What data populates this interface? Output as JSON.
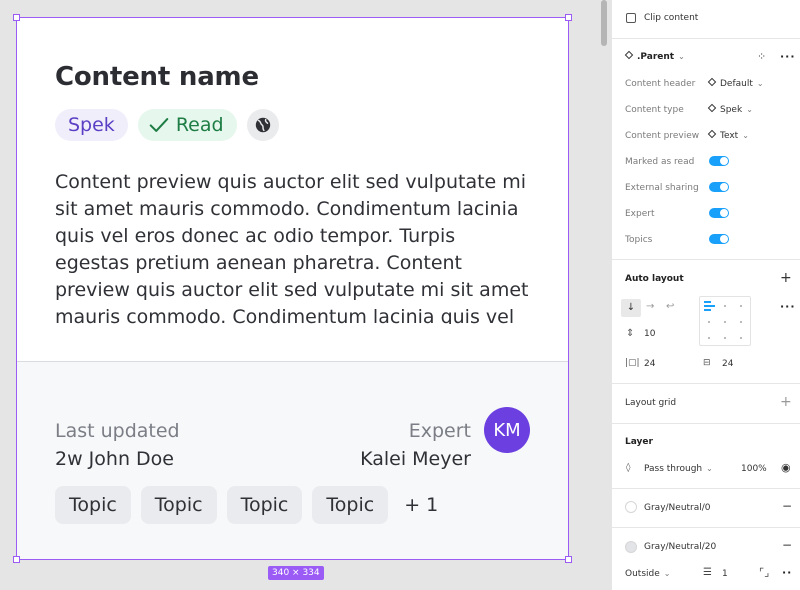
{
  "card": {
    "title": "Content name",
    "tags": {
      "spek": "Spek",
      "read": "Read"
    },
    "preview": "Content preview quis auctor elit sed vulputate mi sit amet mauris commodo. Condimentum lacinia quis vel eros donec ac odio tempor. Turpis egestas pretium aenean pharetra. Content preview quis auctor elit sed vulputate mi sit amet mauris commodo. Condimentum lacinia quis vel eros",
    "last_updated_label": "Last updated",
    "last_updated_value": "2w John Doe",
    "expert_label": "Expert",
    "expert_name": "Kalei Meyer",
    "avatar_initials": "KM",
    "topics": [
      "Topic",
      "Topic",
      "Topic",
      "Topic"
    ],
    "topics_more": "+ 1"
  },
  "canvas": {
    "size_badge": "340 × 334"
  },
  "panel": {
    "clip_content": "Clip content",
    "component_name": ".Parent",
    "props": [
      {
        "label": "Content header",
        "value": "Default"
      },
      {
        "label": "Content type",
        "value": "Spek"
      },
      {
        "label": "Content preview",
        "value": "Text"
      }
    ],
    "toggles": [
      {
        "label": "Marked as read",
        "on": true
      },
      {
        "label": "External sharing",
        "on": true
      },
      {
        "label": "Expert",
        "on": true
      },
      {
        "label": "Topics",
        "on": true
      }
    ],
    "auto_layout": {
      "title": "Auto layout",
      "spacing": "10",
      "padding_h": "24",
      "padding_v": "24"
    },
    "layout_grid": "Layout grid",
    "layer": {
      "title": "Layer",
      "blend": "Pass through",
      "opacity": "100%"
    },
    "fills": [
      "Gray/Neutral/0",
      "Gray/Neutral/20"
    ],
    "stroke": {
      "position": "Outside",
      "weight": "1"
    }
  },
  "colors": {
    "selection": "#9b5cf6",
    "avatar": "#6b3fe0",
    "toggle": "#18a0fb",
    "read_tag_text": "#1e7d44",
    "spek_tag_text": "#5b3fc4"
  }
}
